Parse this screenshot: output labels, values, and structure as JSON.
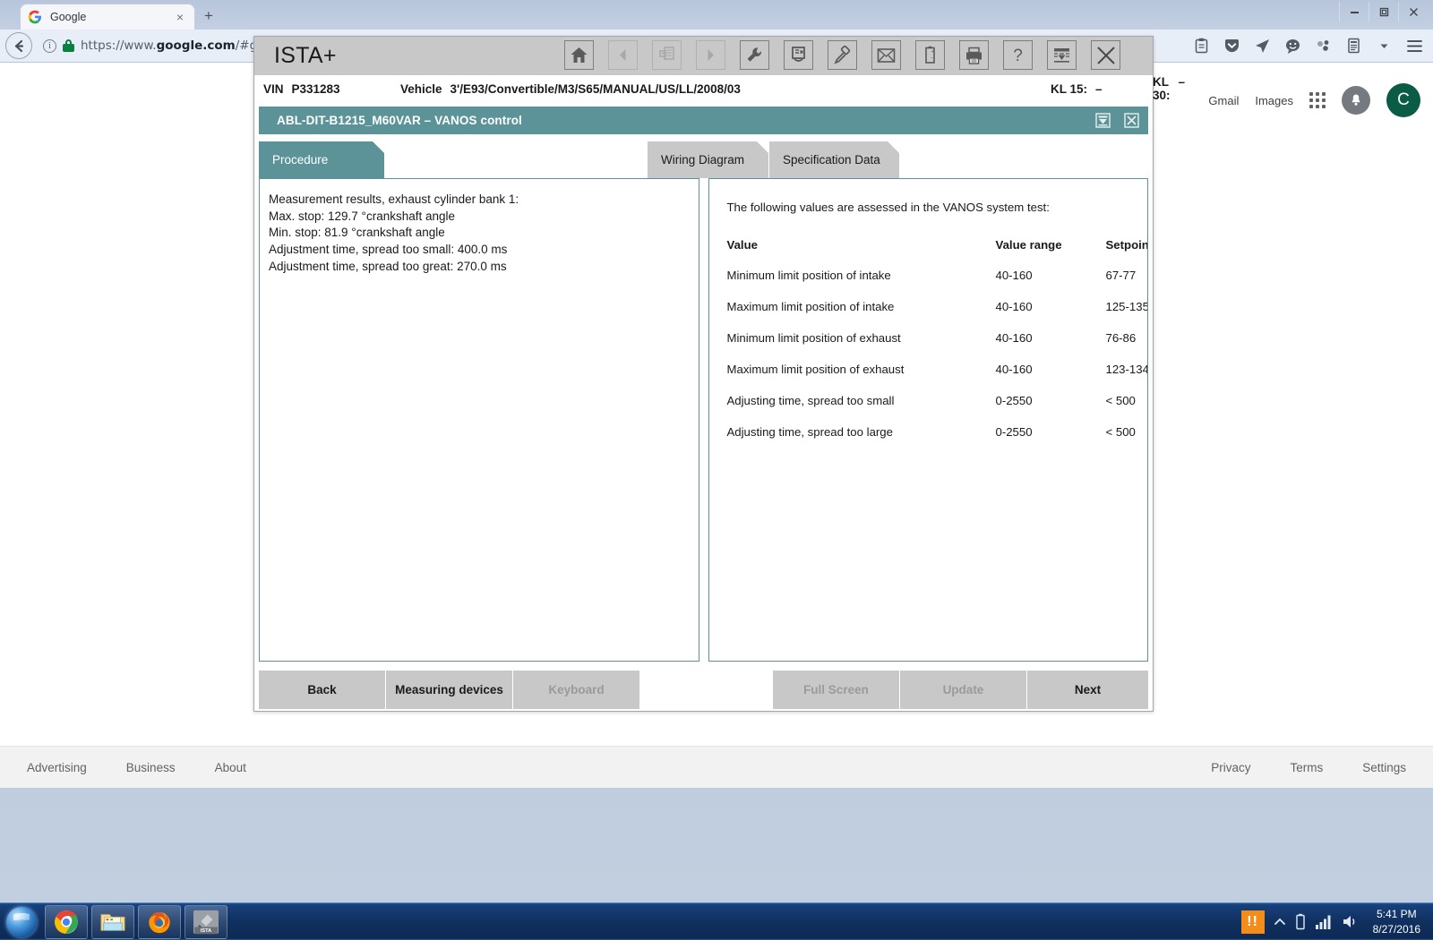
{
  "browser": {
    "tab": {
      "title": "Google",
      "favicon": "google-favicon",
      "close_label": "×"
    },
    "new_tab_label": "+",
    "window_buttons": {
      "minimize": "—",
      "maximize": "❐",
      "close": "✕"
    },
    "url_prefix": "https://www.",
    "url_bold": "google.com",
    "url_suffix": "/#gws_rd=ss",
    "security": {
      "info_icon": "info-icon",
      "lock_icon": "lock-icon"
    },
    "nav": {
      "back": "back-arrow-icon",
      "forward": "forward-arrow-icon"
    },
    "omni_icons": [
      "clipboard-icon",
      "pocket-icon",
      "send-icon",
      "chat-icon",
      "molecule-icon",
      "reader-icon",
      "chevron-down-icon",
      "menu-icon"
    ]
  },
  "google_page": {
    "links": [
      "Gmail",
      "Images"
    ],
    "apps_icon": "apps-grid-icon",
    "notifications_icon": "bell-icon",
    "account_initial": "C",
    "footer_left": [
      "Advertising",
      "Business",
      "About"
    ],
    "footer_right": [
      "Privacy",
      "Terms",
      "Settings"
    ]
  },
  "ista": {
    "app_title": "ISTA+",
    "toolbar_icons": [
      "home-icon",
      "back-arrow-icon",
      "documents-icon",
      "forward-arrow-icon",
      "wrench-icon",
      "service-plan-icon",
      "connector-icon",
      "mail-icon",
      "battery-icon",
      "print-icon",
      "help-icon",
      "collapse-icon",
      "close-icon"
    ],
    "vin_label": "VIN",
    "vin_value": "P331283",
    "vehicle_label": "Vehicle",
    "vehicle_value": "3'/E93/Convertible/M3/S65/MANUAL/US/LL/2008/03",
    "kl15_label": "KL 15:",
    "kl15_value": "–",
    "kl30_label": "KL 30:",
    "kl30_value": "–",
    "procedure_id": "ABL-DIT-B1215_M60VAR  –  VANOS control",
    "subheader_buttons": [
      "minimize-panel-icon",
      "close-panel-icon"
    ],
    "tabs": [
      {
        "label": "Procedure",
        "active": true
      },
      {
        "label": "Wiring Diagram",
        "active": false
      },
      {
        "label": "Specification Data",
        "active": false
      }
    ],
    "procedure_panel": {
      "heading": "Measurement results, exhaust cylinder bank 1:",
      "lines": [
        "Max. stop: 129.7  °crankshaft angle",
        "Min. stop: 81.9  °crankshaft angle"
      ],
      "lines2": [
        "Adjustment time, spread too small: 400.0  ms",
        "Adjustment time, spread too great: 270.0  ms"
      ]
    },
    "spec_panel": {
      "intro": "The following values are assessed in the VANOS system test:",
      "headers": [
        "Value",
        "Value range",
        "Setpoint"
      ],
      "rows": [
        {
          "value": "Minimum limit position of intake",
          "range": "40-160",
          "setpoint": "67-77"
        },
        {
          "value": "Maximum limit position of intake",
          "range": "40-160",
          "setpoint": "125-135"
        },
        {
          "value": "Minimum limit position of exhaust",
          "range": "40-160",
          "setpoint": "76-86"
        },
        {
          "value": "Maximum limit position of exhaust",
          "range": "40-160",
          "setpoint": "123-134"
        },
        {
          "value": "Adjusting time, spread too small",
          "range": "0-2550",
          "setpoint": "< 500"
        },
        {
          "value": "Adjusting time, spread too large",
          "range": "0-2550",
          "setpoint": "< 500"
        }
      ]
    },
    "buttons": [
      {
        "label": "Back",
        "enabled": true
      },
      {
        "label": "Measuring devices",
        "enabled": true
      },
      {
        "label": "Keyboard",
        "enabled": false
      },
      {
        "label": "Full Screen",
        "enabled": false
      },
      {
        "label": "Update",
        "enabled": false
      },
      {
        "label": "Next",
        "enabled": true
      }
    ],
    "colors": {
      "accent": "#5b9398",
      "chrome": "#c8c8c8"
    }
  },
  "taskbar": {
    "start_icon": "windows-start-orb",
    "items": [
      "chrome-icon",
      "file-explorer-icon",
      "firefox-icon",
      "ista-icon"
    ],
    "tray": {
      "warn_icon": "warning-icon",
      "show_hidden_icon": "chevron-up-icon",
      "battery_icon": "battery-icon",
      "network_icon": "signal-bars-icon",
      "volume_icon": "speaker-icon",
      "time": "5:41 PM",
      "date": "8/27/2016"
    }
  }
}
